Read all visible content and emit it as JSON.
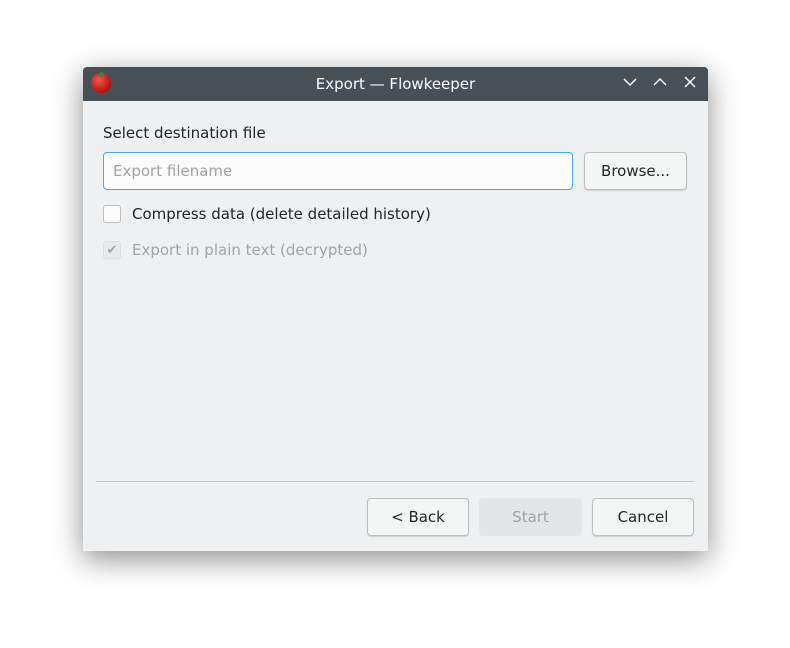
{
  "window": {
    "title": "Export — Flowkeeper",
    "controls": {
      "minimize": "⌄",
      "maximize": "⌃",
      "close": "✕"
    }
  },
  "form": {
    "label": "Select destination file",
    "filename": {
      "value": "",
      "placeholder": "Export filename"
    },
    "browse_label": "Browse...",
    "compress": {
      "label": "Compress data (delete detailed history)",
      "checked": false
    },
    "plaintext": {
      "label": "Export in plain text (decrypted)",
      "checked": true,
      "disabled": true,
      "check_glyph": "✔"
    }
  },
  "footer": {
    "back_label": "< Back",
    "start_label": "Start",
    "cancel_label": "Cancel"
  },
  "colors": {
    "titlebar": "#475057",
    "focus": "#3daee9",
    "background": "#eff0f1"
  }
}
